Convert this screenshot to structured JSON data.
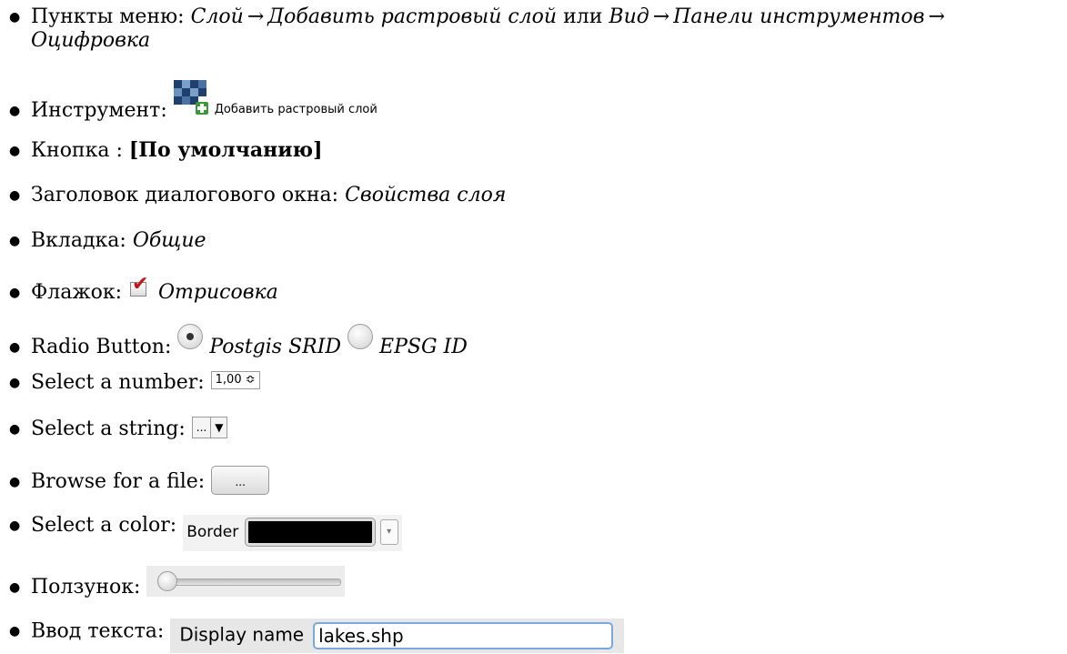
{
  "items": {
    "menu": {
      "label": "Пункты меню:",
      "path1_a": "Слой",
      "path1_b": "Добавить растровый слой",
      "or": "или",
      "path2_a": "Вид",
      "path2_b": "Панели инструментов",
      "path2_c": "Оцифровка",
      "arrow": "→"
    },
    "tool": {
      "label": "Инструмент:",
      "tool_name": "Добавить растровый слой"
    },
    "button": {
      "label": "Кнопка :",
      "value": "[По умолчанию]"
    },
    "dialog": {
      "label": "Заголовок диалогового окна:",
      "value": "Свойства слоя"
    },
    "tab": {
      "label": "Вкладка:",
      "value": "Общие"
    },
    "checkbox": {
      "label": "Флажок:",
      "value": "Отрисовка"
    },
    "radio": {
      "label": "Radio Button:",
      "opt1": "Postgis SRID",
      "opt2": "EPSG ID"
    },
    "number": {
      "label": "Select a number:",
      "value": "1,00 ≎"
    },
    "string": {
      "label": "Select a string:",
      "value": "...",
      "arrow": "▼"
    },
    "file": {
      "label": "Browse for a file:",
      "value": "..."
    },
    "color": {
      "label": "Select a color:",
      "field_label": "Border",
      "swatch_color": "#000000",
      "arrow": "▾"
    },
    "slider": {
      "label": "Ползунок:",
      "level": 0
    },
    "text": {
      "label": "Ввод текста:",
      "field_label": "Display name",
      "value": "lakes.shp"
    }
  }
}
